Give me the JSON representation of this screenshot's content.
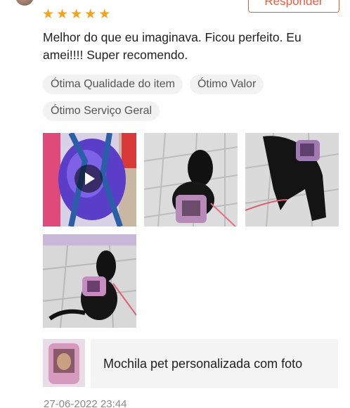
{
  "reviewer": {
    "avatar": "avatar"
  },
  "rating": {
    "value": 5,
    "max": 5,
    "star_glyph": "★",
    "color": "#f7a21b"
  },
  "reply_button": {
    "label": "Responder",
    "color": "#f05a3a"
  },
  "review": {
    "text": "Melhor do que eu imaginava. Ficou perfeito. Eu amei!!!! Super recomendo."
  },
  "tags": [
    {
      "label": "Ótima Qualidade do item"
    },
    {
      "label": "Ótimo Valor"
    },
    {
      "label": "Ótimo Serviço Geral"
    }
  ],
  "media": [
    {
      "type": "video",
      "icon": "play-icon",
      "subject": "purple pet backpack"
    },
    {
      "type": "photo",
      "subject": "black dog wearing backpack"
    },
    {
      "type": "photo",
      "subject": "black dog wearing backpack"
    },
    {
      "type": "photo",
      "subject": "black dog wearing backpack"
    }
  ],
  "product": {
    "name": "Mochila pet personalizada com foto"
  },
  "timestamp": "27-06-2022 23:44"
}
